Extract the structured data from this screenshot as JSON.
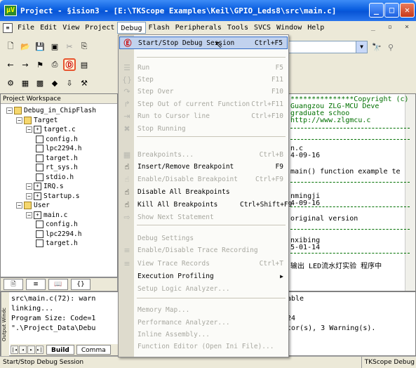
{
  "window": {
    "title": "Project  - §ision3 - [E:\\TKScope Examples\\Keil\\GPIO_Leds8\\src\\main.c]",
    "app_icon": "µV"
  },
  "menubar": {
    "items": [
      "File",
      "Edit",
      "View",
      "Project",
      "Debug",
      "Flash",
      "Peripherals",
      "Tools",
      "SVCS",
      "Window",
      "Help"
    ],
    "active": "Debug"
  },
  "workspace": {
    "title": "Project Workspace",
    "tree": [
      {
        "label": "Debug_in_ChipFlash",
        "level": 0,
        "kind": "root"
      },
      {
        "label": "Target",
        "level": 1,
        "kind": "folder"
      },
      {
        "label": "target.c",
        "level": 2,
        "kind": "file-exp"
      },
      {
        "label": "config.h",
        "level": 3,
        "kind": "file"
      },
      {
        "label": "lpc2294.h",
        "level": 3,
        "kind": "file"
      },
      {
        "label": "target.h",
        "level": 3,
        "kind": "file"
      },
      {
        "label": "rt_sys.h",
        "level": 3,
        "kind": "file"
      },
      {
        "label": "stdio.h",
        "level": 3,
        "kind": "file"
      },
      {
        "label": "IRQ.s",
        "level": 2,
        "kind": "file-exp"
      },
      {
        "label": "Startup.s",
        "level": 2,
        "kind": "file-exp"
      },
      {
        "label": "User",
        "level": 1,
        "kind": "folder"
      },
      {
        "label": "main.c",
        "level": 2,
        "kind": "file-exp"
      },
      {
        "label": "config.h",
        "level": 3,
        "kind": "file"
      },
      {
        "label": "lpc2294.h",
        "level": 3,
        "kind": "file"
      },
      {
        "label": "target.h",
        "level": 3,
        "kind": "file"
      }
    ]
  },
  "editor": {
    "lines": [
      "***************Copyright (c)",
      "   Guangzou ZLG-MCU Deve",
      "        graduate schoo",
      "     http://www.zlgmcu.c",
      "n.c",
      "4-09-16",
      " main() function example te",
      "nmingji",
      "4-09-16",
      " original version",
      "nxibing",
      "5-01-14",
      "输出  LED流水灯实验  程序中"
    ]
  },
  "debug_menu": {
    "items": [
      {
        "label": "Start/Stop Debug Session",
        "shortcut": "Ctrl+F5",
        "icon": "debug-session-icon",
        "glyph": "Ⓔ",
        "enabled": true,
        "highlighted": true
      },
      {
        "label": "Run",
        "shortcut": "F5",
        "icon": "run-icon",
        "glyph": "☰",
        "enabled": false
      },
      {
        "label": "Step",
        "shortcut": "F11",
        "icon": "step-icon",
        "glyph": "{}",
        "enabled": false
      },
      {
        "label": "Step Over",
        "shortcut": "F10",
        "icon": "step-over-icon",
        "glyph": "↷",
        "enabled": false
      },
      {
        "label": "Step Out of current Function",
        "shortcut": "Ctrl+F11",
        "icon": "step-out-icon",
        "glyph": "↱",
        "enabled": false
      },
      {
        "label": "Run to Cursor line",
        "shortcut": "Ctrl+F10",
        "icon": "run-to-cursor-icon",
        "glyph": "⇥",
        "enabled": false
      },
      {
        "label": "Stop Running",
        "shortcut": "",
        "icon": "stop-icon",
        "glyph": "✖",
        "enabled": false
      },
      {
        "label": "Breakpoints...",
        "shortcut": "Ctrl+B",
        "icon": "breakpoints-icon",
        "glyph": "▦",
        "enabled": false
      },
      {
        "label": "Insert/Remove Breakpoint",
        "shortcut": "F9",
        "icon": "hand-icon",
        "glyph": "☝",
        "enabled": true
      },
      {
        "label": "Enable/Disable Breakpoint",
        "shortcut": "Ctrl+F9",
        "icon": "toggle-breakpoint-icon",
        "glyph": "☝",
        "enabled": false
      },
      {
        "label": "Disable All Breakpoints",
        "shortcut": "",
        "icon": "disable-all-icon",
        "glyph": "☝",
        "enabled": true
      },
      {
        "label": "Kill All Breakpoints",
        "shortcut": "Ctrl+Shift+F9",
        "icon": "kill-all-icon",
        "glyph": "☝",
        "enabled": true
      },
      {
        "label": "Show Next Statement",
        "shortcut": "",
        "icon": "next-statement-icon",
        "glyph": "⇨",
        "enabled": false
      },
      {
        "label": "Debug Settings",
        "shortcut": "",
        "icon": "",
        "glyph": "",
        "enabled": false
      },
      {
        "label": "Enable/Disable Trace Recording",
        "shortcut": "",
        "icon": "trace-icon",
        "glyph": "≡",
        "enabled": false
      },
      {
        "label": "View Trace Records",
        "shortcut": "Ctrl+T",
        "icon": "view-trace-icon",
        "glyph": "≡",
        "enabled": false
      },
      {
        "label": "Execution Profiling",
        "shortcut": "",
        "icon": "",
        "glyph": "",
        "enabled": true,
        "submenu": true
      },
      {
        "label": "Setup Logic Analyzer...",
        "shortcut": "",
        "icon": "",
        "glyph": "",
        "enabled": false
      },
      {
        "label": "Memory Map...",
        "shortcut": "",
        "icon": "",
        "glyph": "",
        "enabled": false
      },
      {
        "label": "Performance Analyzer...",
        "shortcut": "",
        "icon": "",
        "glyph": "",
        "enabled": false
      },
      {
        "label": "Inline Assembly...",
        "shortcut": "",
        "icon": "",
        "glyph": "",
        "enabled": false
      },
      {
        "label": "Function Editor (Open Ini File)...",
        "shortcut": "",
        "icon": "",
        "glyph": "",
        "enabled": false
      }
    ]
  },
  "output": {
    "side_label": "Output Windc",
    "lines": [
      "src\\main.c(72): warn",
      "linking...",
      "Program Size: Code=1",
      "\".\\Project_Data\\Debu"
    ],
    "right_lines": [
      "able",
      "",
      "24",
      "tor(s), 3 Warning(s)."
    ],
    "tabs": [
      "Build",
      "Comma"
    ],
    "active_tab": "Build"
  },
  "status": {
    "left": "Start/Stop Debug Session",
    "right": "TKScope Debug"
  }
}
